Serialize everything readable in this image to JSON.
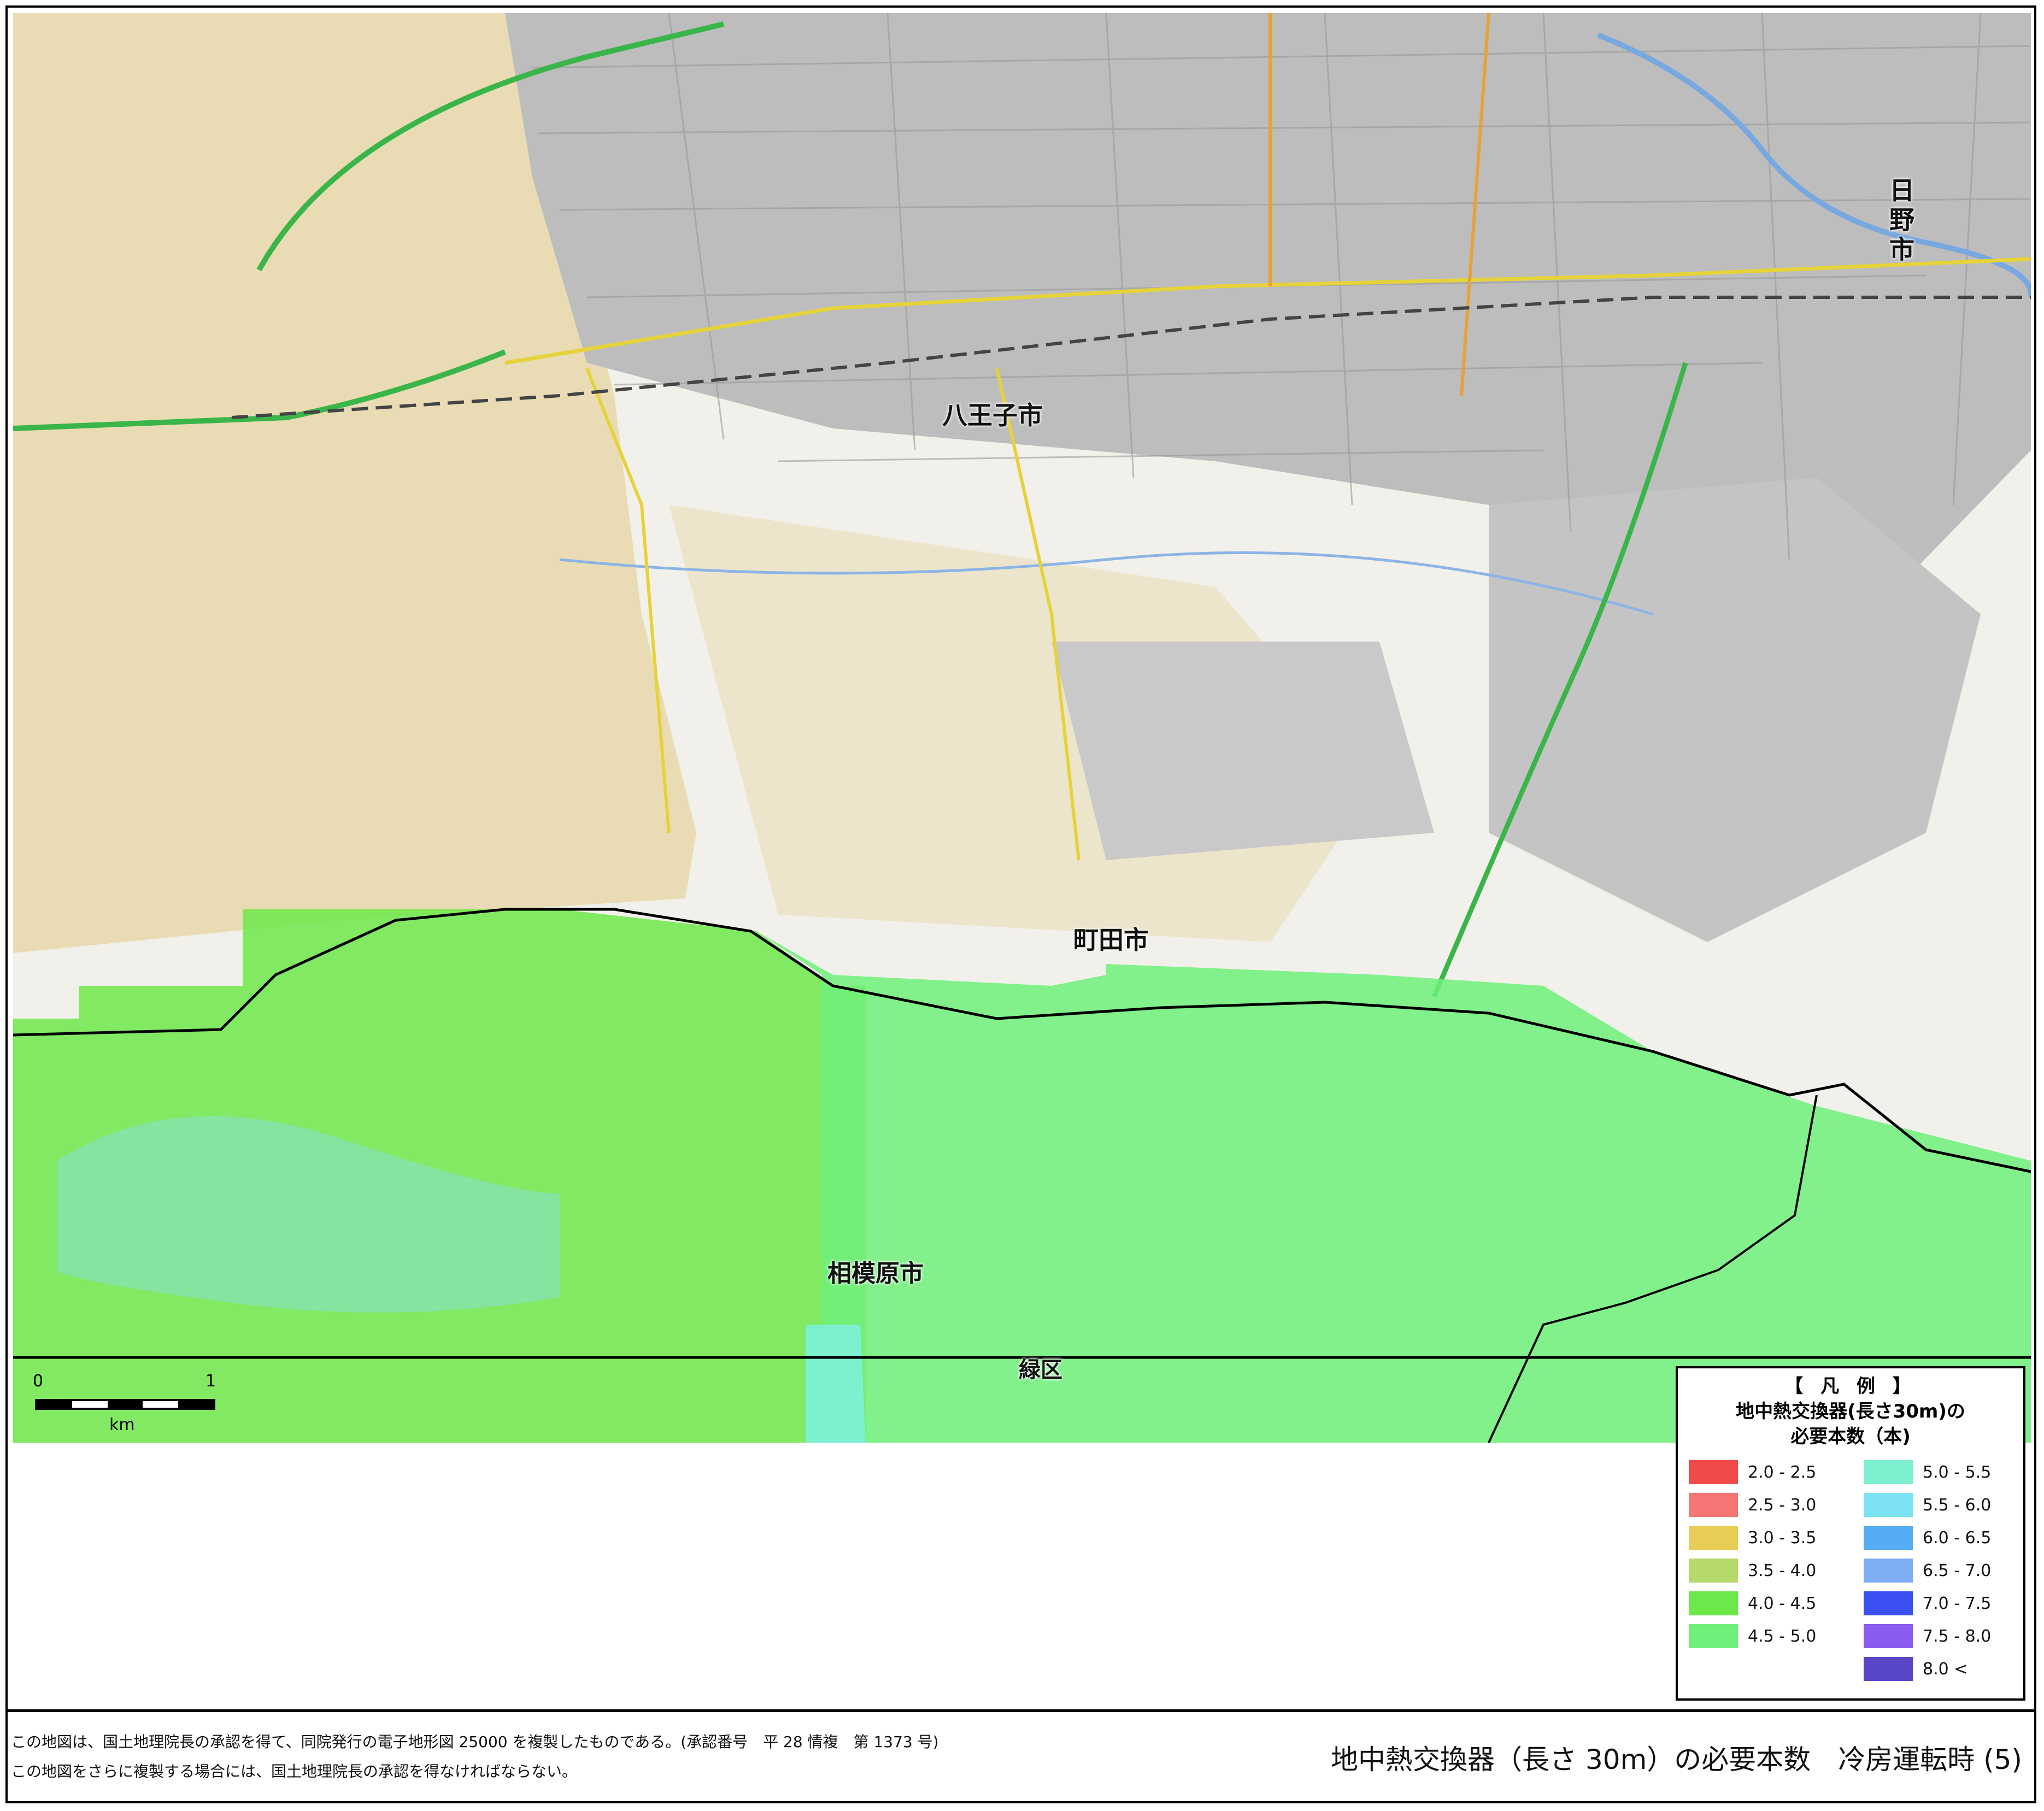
{
  "map": {
    "cities": {
      "hachioji": "八王子市",
      "hino": "日野市",
      "machida": "町田市",
      "sagamihara": "相模原市",
      "midori": "緑区"
    }
  },
  "scale": {
    "start": "0",
    "end": "1",
    "unit": "km"
  },
  "legend": {
    "title1": "【 凡 例 】",
    "title2": "地中熱交換器(長さ30m)の",
    "title3": "必要本数（本)",
    "items": [
      {
        "range": "2.0 - 2.5",
        "color": "#f04a4a"
      },
      {
        "range": "2.5 - 3.0",
        "color": "#f57575"
      },
      {
        "range": "3.0 - 3.5",
        "color": "#e8cc55"
      },
      {
        "range": "3.5 - 4.0",
        "color": "#b5d96b"
      },
      {
        "range": "4.0 - 4.5",
        "color": "#6de84a"
      },
      {
        "range": "4.5 - 5.0",
        "color": "#6ff07a"
      },
      {
        "range": "5.0 - 5.5",
        "color": "#7df0cf"
      },
      {
        "range": "5.5 - 6.0",
        "color": "#7de3f3"
      },
      {
        "range": "6.0 - 6.5",
        "color": "#56acf2"
      },
      {
        "range": "6.5 - 7.0",
        "color": "#7faef5"
      },
      {
        "range": "7.0 - 7.5",
        "color": "#3a50f0"
      },
      {
        "range": "7.5 - 8.0",
        "color": "#8a5cf0"
      },
      {
        "range": "8.0 <",
        "color": "#5848c8"
      }
    ]
  },
  "footer": {
    "note1": "この地図は、国土地理院長の承認を得て、同院発行の電子地形図 25000 を複製したものである。(承認番号　平 28 情複　第 1373 号)",
    "note2": "この地図をさらに複製する場合には、国土地理院長の承認を得なければならない。",
    "title": "地中熱交換器（長さ 30m）の必要本数　冷房運転時 (5)"
  }
}
